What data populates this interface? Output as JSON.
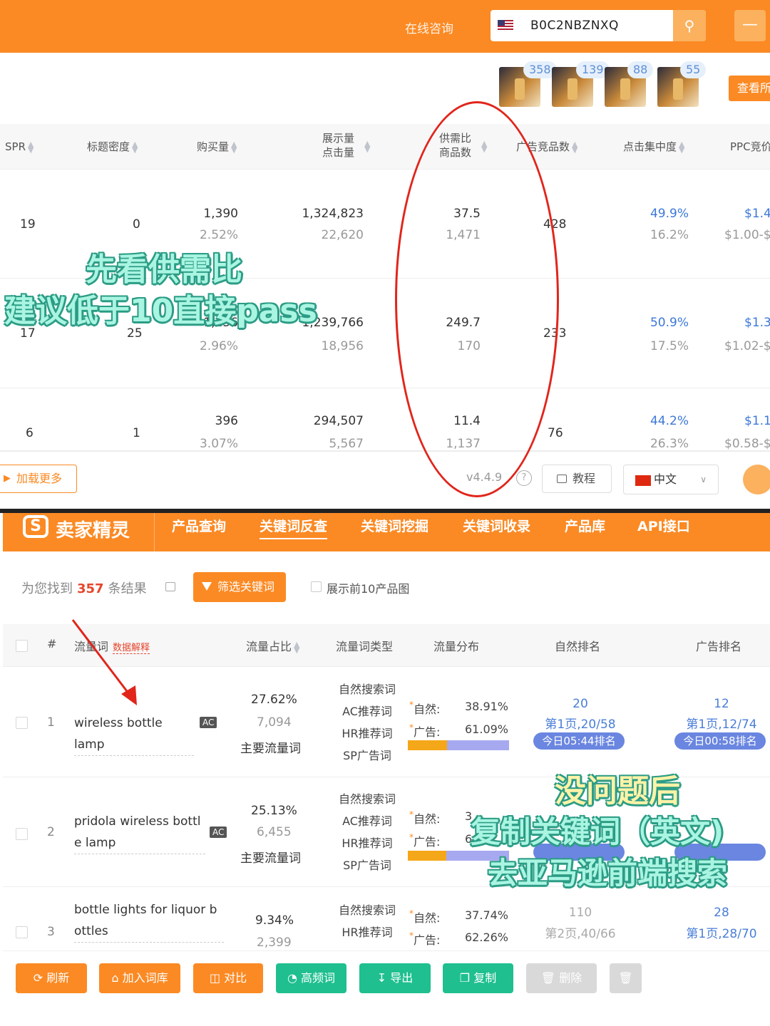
{
  "top_panel": {
    "consult": "在线咨询",
    "asin": "B0C2NBZNXQ",
    "thumb_badges": [
      "358",
      "139",
      "88",
      "55"
    ],
    "view_all": "查看所",
    "headers": {
      "spr": "SPR",
      "title_density": "标题密度",
      "purchases": "购买量",
      "impressions": "展示量",
      "clicks": "点击量",
      "supply_demand": "供需比",
      "product_count": "商品数",
      "ad_products": "广告竞品数",
      "click_concentration": "点击集中度",
      "ppc": "PPC竞价"
    },
    "rows": [
      {
        "spr": "19",
        "density": "0",
        "purchases": "1,390",
        "purchase_rate": "2.52%",
        "impressions": "1,324,823",
        "clicks": "22,620",
        "supply_demand": "37.5",
        "products": "1,471",
        "ad_products": "428",
        "concentration": "49.9%",
        "concentration_sub": "16.2%",
        "ppc": "$1.4",
        "ppc_range": "$1.00-$"
      },
      {
        "spr": "17",
        "density": "25",
        "purchases": "1,256",
        "purchase_rate": "2.96%",
        "impressions": "1,239,766",
        "clicks": "18,956",
        "supply_demand": "249.7",
        "products": "170",
        "ad_products": "233",
        "concentration": "50.9%",
        "concentration_sub": "17.5%",
        "ppc": "$1.3",
        "ppc_range": "$1.02-$"
      },
      {
        "spr": "6",
        "density": "1",
        "purchases": "396",
        "purchase_rate": "3.07%",
        "impressions": "294,507",
        "clicks": "5,567",
        "supply_demand": "11.4",
        "products": "1,137",
        "ad_products": "76",
        "concentration": "44.2%",
        "concentration_sub": "26.3%",
        "ppc": "$1.1",
        "ppc_range": "$0.58-$"
      }
    ],
    "load_more": "加载更多",
    "version": "v4.4.9",
    "tutorial": "教程",
    "language": "中文"
  },
  "bottom_panel": {
    "brand": "卖家精灵",
    "logo_letter": "S",
    "nav": [
      "产品查询",
      "关键词反查",
      "关键词挖掘",
      "关键词收录",
      "产品库",
      "API接口"
    ],
    "results_prefix": "为您找到",
    "results_count": "357",
    "results_suffix": "条结果",
    "filter_btn": "筛选关键词",
    "top10_label": "展示前10产品图",
    "headers": {
      "index": "#",
      "keyword": "流量词",
      "data_explain": "数据解释",
      "traffic_share": "流量占比",
      "type": "流量词类型",
      "distribution": "流量分布",
      "organic_rank": "自然排名",
      "ad_rank": "广告排名"
    },
    "dist_labels": {
      "organic": "自然:",
      "ad": "广告:"
    },
    "rows": [
      {
        "index": "1",
        "keyword": "wireless bottle lamp",
        "tag": "AC",
        "share": "27.62%",
        "volume": "7,094",
        "main": "主要流量词",
        "types": [
          "自然搜索词",
          "AC推荐词",
          "HR推荐词",
          "SP广告词"
        ],
        "organic_pct": "38.91%",
        "ad_pct": "61.09%",
        "organic_frac": 0.3891,
        "organic_rank": "20",
        "organic_pos": "第1页,20/58",
        "organic_time": "今日05:44排名",
        "ad_rank": "12",
        "ad_pos": "第1页,12/74",
        "ad_time": "今日00:58排名"
      },
      {
        "index": "2",
        "keyword_line1": "pridola wireless bottl",
        "keyword_line2": "e lamp",
        "tag": "AC",
        "share": "25.13%",
        "volume": "6,455",
        "main": "主要流量词",
        "types": [
          "自然搜索词",
          "AC推荐词",
          "HR推荐词",
          "SP广告词"
        ],
        "organic_pct": "3",
        "ad_pct": "6",
        "organic_frac": 0.38
      },
      {
        "index": "3",
        "keyword_line1": "bottle lights for liquor b",
        "keyword_line2": "ottles",
        "share": "9.34%",
        "volume": "2,399",
        "types": [
          "自然搜索词",
          "HR推荐词"
        ],
        "organic_pct": "37.74%",
        "ad_pct": "62.26%",
        "organic_rank": "110",
        "organic_pos": "第2页,40/66",
        "ad_rank": "28",
        "ad_pos": "第1页,28/70"
      }
    ],
    "actions": [
      "刷新",
      "加入词库",
      "对比",
      "高频词",
      "导出",
      "复制",
      "删除"
    ]
  },
  "overlays": {
    "cap1_line1": "先看供需比",
    "cap1_line2": "建议低于10直接pass",
    "cap2_line1": "没问题后",
    "cap2_line2": "复制关键词（英文)",
    "cap2_line3": "去亚马逊前端搜索"
  },
  "colors": {
    "brand_orange": "#fb8a24",
    "action_green": "#1fbf8f",
    "rank_blue": "#4a7ed8",
    "annotation_red": "#e1251b"
  }
}
